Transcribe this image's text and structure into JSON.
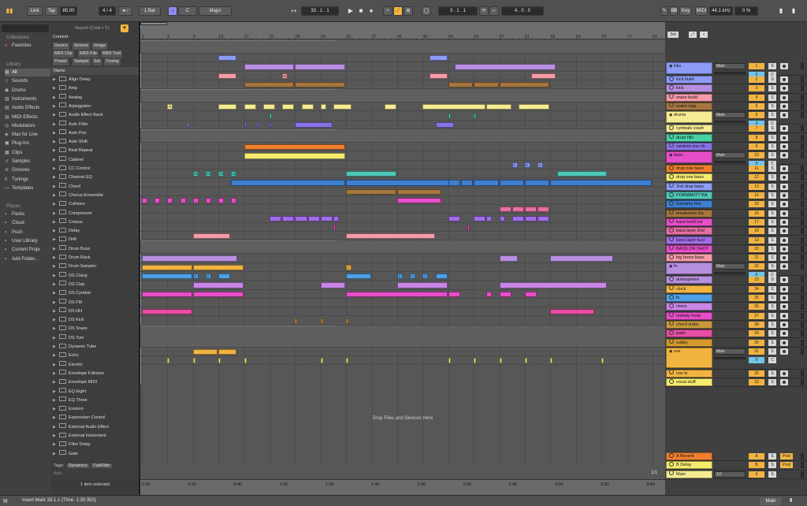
{
  "toolbar": {
    "link": "Link",
    "tap": "Tap",
    "tempo": "85.00",
    "signature": "4 / 4",
    "metronome": "●○",
    "quantize": "1 Bar",
    "key": "C",
    "scale": "Major",
    "position": "33 .  1 .  1",
    "loop_start": "3 .  1 .  1",
    "loop_length": "4 .  0 .  0",
    "key_btn": "Key",
    "midi_btn": "MIDI",
    "sample_rate": "44.1 kHz",
    "cpu": "0 %"
  },
  "sidebar": {
    "search_placeholder": "Search (Cmd + F)",
    "collections_header": "Collections",
    "favorites": "Favorites",
    "library_header": "Library",
    "library_items": [
      "All",
      "Sounds",
      "Drums",
      "Instruments",
      "Audio Effects",
      "MIDI Effects",
      "Modulators",
      "Max for Live",
      "Plug-Ins",
      "Clips",
      "Samples",
      "Grooves",
      "Tunings",
      "Templates"
    ],
    "places_header": "Places",
    "places_items": [
      "Packs",
      "Cloud",
      "Push",
      "User Library",
      "Current Proje",
      "Add Folder..."
    ]
  },
  "browser": {
    "content_label": "Content",
    "filters": [
      "Device",
      "Groove",
      "Image",
      "MIDI Clip",
      "MIDI File",
      "MIDI Tool",
      "Preset",
      "Sample",
      "Set",
      "Tuning"
    ],
    "name_header": "Name",
    "items": [
      "Align Delay",
      "Amp",
      "Analog",
      "Arpeggiator",
      "Audio Effect Rack",
      "Auto Filter",
      "Auto Pan",
      "Auto Shift",
      "Beat Repeat",
      "Cabinet",
      "CC Control",
      "Channel EQ",
      "Chord",
      "Chorus-Ensemble",
      "Collision",
      "Compressor",
      "Corpus",
      "Delay",
      "Drift",
      "Drum Buss",
      "Drum Rack",
      "Drum Sampler",
      "DS Clang",
      "DS Clap",
      "DS Cymbal",
      "DS FM",
      "DS HH",
      "DS Kick",
      "DS Snare",
      "DS Tom",
      "Dynamic Tube",
      "Echo",
      "Electric",
      "Envelope Follower",
      "Envelope MIDI",
      "EQ Eight",
      "EQ Three",
      "Erosion",
      "Expression Control",
      "External Audio Effect",
      "External Instrument",
      "Filter Delay",
      "Gate"
    ],
    "tags_label": "Tags:",
    "tags": [
      "Dynamics",
      "FabFilter"
    ],
    "add_label": "Add...",
    "selected_count": "1 item selected"
  },
  "arrangement": {
    "bars": [
      "1",
      "5",
      "9",
      "13",
      "17",
      "21",
      "25",
      "29",
      "33",
      "37",
      "41",
      "45",
      "49",
      "53",
      "57",
      "61",
      "65",
      "69",
      "73",
      "77",
      "81"
    ],
    "times": [
      "0:00",
      "0:20",
      "0:40",
      "1:00",
      "1:20",
      "1:40",
      "2:00",
      "2:20",
      "2:40",
      "3:00",
      "3:20",
      "3:40"
    ],
    "drop_text": "Drop Files and Devices Here",
    "set_label": "Set",
    "page_indicator": "1/1"
  },
  "tracks": [
    {
      "name": "k&s",
      "num": "1",
      "group": true,
      "io": "Main",
      "color": "#8c9cf7",
      "h": 17
    },
    {
      "name": "kick build",
      "num": "2",
      "color": "#8c9cf7",
      "h": 11.3
    },
    {
      "name": "kick",
      "num": "3",
      "color": "#b78fe0",
      "h": 11.3
    },
    {
      "name": "snare build",
      "num": "4",
      "color": "#f59aa7",
      "h": 11.3
    },
    {
      "name": "snare clap",
      "num": "5",
      "color": "#a5763f",
      "h": 11.3
    },
    {
      "name": "drums",
      "num": "6",
      "group": true,
      "io": "Main",
      "color": "#f5eb92",
      "h": 17
    },
    {
      "name": "cymbals crash",
      "num": "7",
      "color": "#f5eb92",
      "h": 11.3
    },
    {
      "name": "drum fills",
      "num": "8",
      "color": "#49d1a4",
      "h": 11.3
    },
    {
      "name": "random one sh",
      "num": "9",
      "color": "#8a72e6",
      "h": 11.3
    },
    {
      "name": "bass",
      "num": "10",
      "group": true,
      "io": "Main",
      "color": "#e64fc8",
      "h": 17
    },
    {
      "name": "drop one bass",
      "num": "11",
      "color": "#ef7f2e",
      "h": 11.3
    },
    {
      "name": "drop one bass",
      "num": "12",
      "color": "#f5eb6f",
      "h": 11.3
    },
    {
      "name": "2nd drop bass",
      "num": "13",
      "color": "#8c9cf7",
      "h": 11.3
    },
    {
      "name": "FORMANTY BA",
      "num": "14",
      "color": "#4fc7b8",
      "h": 11.3
    },
    {
      "name": "formanty fine",
      "num": "15",
      "color": "#3f7fd0",
      "h": 11.3
    },
    {
      "name": "breakdown ba",
      "num": "16",
      "color": "#a5763f",
      "h": 11.3
    },
    {
      "name": "bass build intr",
      "num": "17",
      "color": "#e64fc8",
      "h": 11.3
    },
    {
      "name": "bass layer 2nd",
      "num": "18",
      "color": "#e66fa3",
      "h": 11.3
    },
    {
      "name": "bass layer fuzz",
      "num": "19",
      "color": "#9f6ce6",
      "h": 11.3
    },
    {
      "name": "BASS ON SHOT",
      "num": "20",
      "color": "#e64fc8",
      "h": 11.3
    },
    {
      "name": "big boom bass",
      "num": "21",
      "color": "#f59aa7",
      "h": 11.3
    },
    {
      "name": "fx",
      "num": "22",
      "group": true,
      "io": "Main",
      "color": "#b78fe0",
      "h": 17
    },
    {
      "name": "atmosphere",
      "num": "23",
      "color": "#b78fe0",
      "h": 11.3
    },
    {
      "name": "clock",
      "num": "24",
      "color": "#f2b441",
      "h": 11.3
    },
    {
      "name": "fx",
      "num": "25",
      "color": "#4fa0e6",
      "h": 11.3
    },
    {
      "name": "risers",
      "num": "26",
      "color": "#c886e6",
      "h": 11.3
    },
    {
      "name": "melody hook",
      "num": "27",
      "color": "#e64fc8",
      "h": 11.3
    },
    {
      "name": "chord stabs",
      "num": "28",
      "color": "#c89a3c",
      "h": 11.3
    },
    {
      "name": "pads",
      "num": "29",
      "color": "#e64fa3",
      "h": 11.3
    },
    {
      "name": "subby",
      "num": "30",
      "color": "#d59a2e",
      "h": 11.3
    },
    {
      "name": "vox",
      "num": "31",
      "group": true,
      "io": "Main",
      "color": "#f2b441",
      "h": 28
    },
    {
      "name": "vox fx",
      "num": "32",
      "color": "#f2b441",
      "h": 11.3
    },
    {
      "name": "vocal stuff",
      "num": "33",
      "color": "#f5eb6f",
      "h": 11.3
    }
  ],
  "returns": [
    {
      "name": "A Reverb",
      "num": "A",
      "post": "Post",
      "color": "#ef7f2e"
    },
    {
      "name": "B Delay",
      "num": "B",
      "post": "Post",
      "color": "#f5eb6f"
    },
    {
      "name": "Main",
      "num": "0",
      "io": "1/2",
      "color": "#f5eb92"
    }
  ],
  "status": {
    "message": "Insert Mark 33.1.1 (Time: 1:30:353)",
    "main_label": "Main"
  }
}
